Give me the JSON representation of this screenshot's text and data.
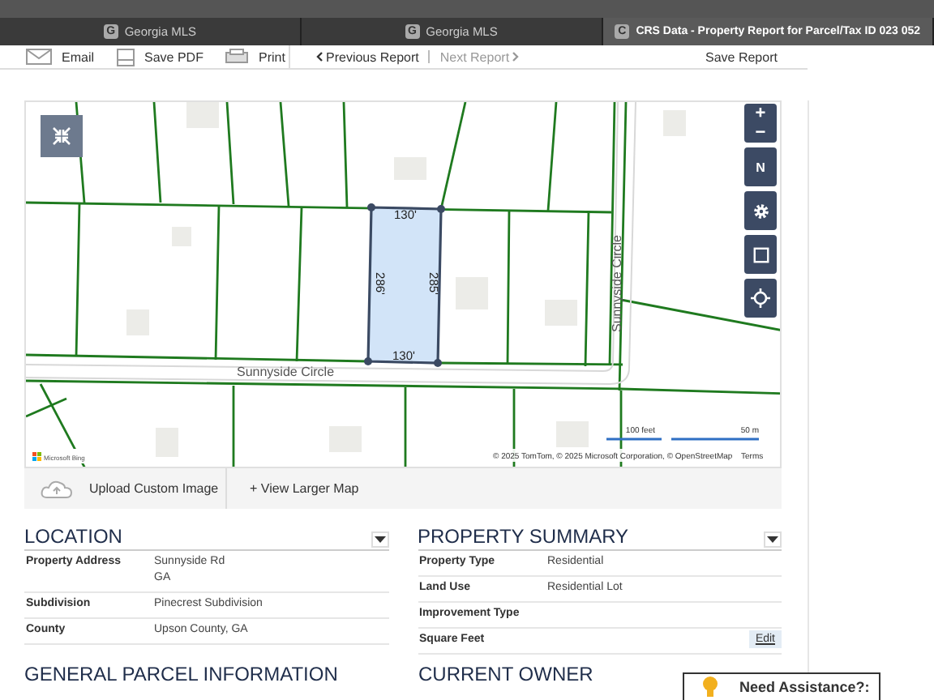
{
  "browser": {
    "tabs": [
      {
        "favicon": "G",
        "title": "Georgia MLS",
        "selected": false
      },
      {
        "favicon": "G",
        "title": "Georgia MLS",
        "selected": false
      },
      {
        "favicon": "C",
        "title": "CRS Data - Property Report for Parcel/Tax ID 023 052",
        "selected": true
      }
    ]
  },
  "toolbar": {
    "actions": [
      {
        "label": "Email",
        "kind": "email"
      },
      {
        "label": "Save PDF",
        "kind": "pdf"
      },
      {
        "label": "Print",
        "kind": "print"
      }
    ],
    "previous": {
      "label": "Previous Report",
      "disabled": false
    },
    "next": {
      "label": "Next Report",
      "disabled": true
    },
    "save_report": "Save Report"
  },
  "map": {
    "parcel_top": "130'",
    "parcel_bottom": "130'",
    "parcel_left": "286'",
    "parcel_right": "285'",
    "street_horizontal": "Sunnyside Circle",
    "street_vertical": "Sunnyside Circle",
    "scale_feet": "100 feet",
    "scale_meters": "50 m",
    "attribution": "© 2025 TomTom, © 2025 Microsoft Corporation, © OpenStreetMap",
    "terms": "Terms",
    "provider": "Microsoft Bing",
    "controls": {
      "zoom_in": "+",
      "zoom_out": "−",
      "north": "N"
    }
  },
  "map_footer": {
    "upload": "Upload Custom Image",
    "larger": "+ View Larger Map"
  },
  "sections": [
    {
      "title": "LOCATION",
      "rows": [
        {
          "label": "Property Address",
          "value": [
            "Sunnyside Rd",
            "GA"
          ]
        },
        {
          "label": "Subdivision",
          "value": [
            "Pinecrest Subdivision"
          ]
        },
        {
          "label": "County",
          "value": [
            "Upson County, GA"
          ]
        }
      ]
    },
    {
      "title": "PROPERTY SUMMARY",
      "rows": [
        {
          "label": "Property Type",
          "value": [
            "Residential"
          ]
        },
        {
          "label": "Land Use",
          "value": [
            "Residential Lot"
          ]
        },
        {
          "label": "Improvement Type",
          "value": []
        },
        {
          "label": "Square Feet",
          "value": [],
          "action": "Edit"
        }
      ]
    }
  ],
  "next_sections": [
    "GENERAL PARCEL INFORMATION",
    "CURRENT OWNER"
  ],
  "assistance": "Need Assistance?:"
}
